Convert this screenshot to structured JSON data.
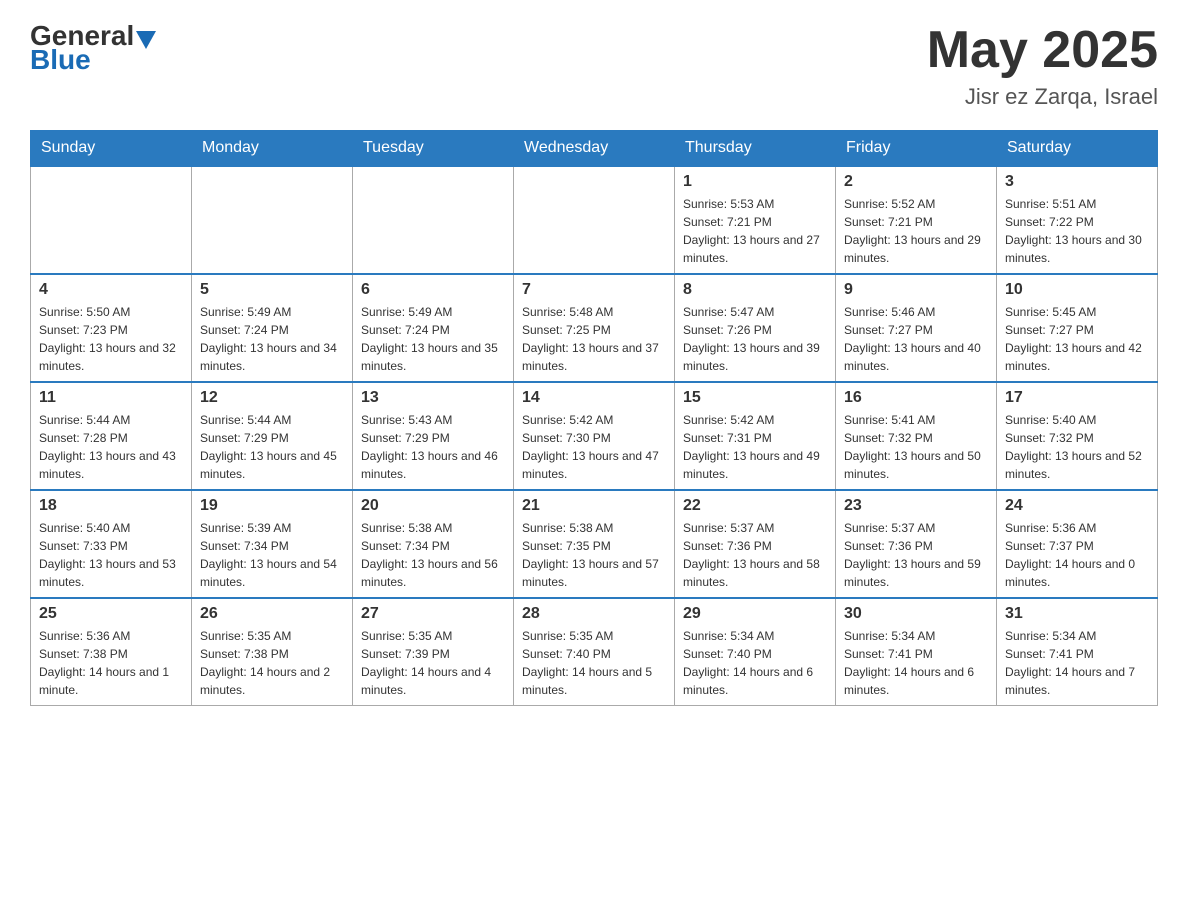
{
  "header": {
    "logo_general": "General",
    "logo_blue": "Blue",
    "main_title": "May 2025",
    "subtitle": "Jisr ez Zarqa, Israel"
  },
  "weekdays": [
    "Sunday",
    "Monday",
    "Tuesday",
    "Wednesday",
    "Thursday",
    "Friday",
    "Saturday"
  ],
  "weeks": [
    [
      {
        "day": "",
        "info": ""
      },
      {
        "day": "",
        "info": ""
      },
      {
        "day": "",
        "info": ""
      },
      {
        "day": "",
        "info": ""
      },
      {
        "day": "1",
        "info": "Sunrise: 5:53 AM\nSunset: 7:21 PM\nDaylight: 13 hours and 27 minutes."
      },
      {
        "day": "2",
        "info": "Sunrise: 5:52 AM\nSunset: 7:21 PM\nDaylight: 13 hours and 29 minutes."
      },
      {
        "day": "3",
        "info": "Sunrise: 5:51 AM\nSunset: 7:22 PM\nDaylight: 13 hours and 30 minutes."
      }
    ],
    [
      {
        "day": "4",
        "info": "Sunrise: 5:50 AM\nSunset: 7:23 PM\nDaylight: 13 hours and 32 minutes."
      },
      {
        "day": "5",
        "info": "Sunrise: 5:49 AM\nSunset: 7:24 PM\nDaylight: 13 hours and 34 minutes."
      },
      {
        "day": "6",
        "info": "Sunrise: 5:49 AM\nSunset: 7:24 PM\nDaylight: 13 hours and 35 minutes."
      },
      {
        "day": "7",
        "info": "Sunrise: 5:48 AM\nSunset: 7:25 PM\nDaylight: 13 hours and 37 minutes."
      },
      {
        "day": "8",
        "info": "Sunrise: 5:47 AM\nSunset: 7:26 PM\nDaylight: 13 hours and 39 minutes."
      },
      {
        "day": "9",
        "info": "Sunrise: 5:46 AM\nSunset: 7:27 PM\nDaylight: 13 hours and 40 minutes."
      },
      {
        "day": "10",
        "info": "Sunrise: 5:45 AM\nSunset: 7:27 PM\nDaylight: 13 hours and 42 minutes."
      }
    ],
    [
      {
        "day": "11",
        "info": "Sunrise: 5:44 AM\nSunset: 7:28 PM\nDaylight: 13 hours and 43 minutes."
      },
      {
        "day": "12",
        "info": "Sunrise: 5:44 AM\nSunset: 7:29 PM\nDaylight: 13 hours and 45 minutes."
      },
      {
        "day": "13",
        "info": "Sunrise: 5:43 AM\nSunset: 7:29 PM\nDaylight: 13 hours and 46 minutes."
      },
      {
        "day": "14",
        "info": "Sunrise: 5:42 AM\nSunset: 7:30 PM\nDaylight: 13 hours and 47 minutes."
      },
      {
        "day": "15",
        "info": "Sunrise: 5:42 AM\nSunset: 7:31 PM\nDaylight: 13 hours and 49 minutes."
      },
      {
        "day": "16",
        "info": "Sunrise: 5:41 AM\nSunset: 7:32 PM\nDaylight: 13 hours and 50 minutes."
      },
      {
        "day": "17",
        "info": "Sunrise: 5:40 AM\nSunset: 7:32 PM\nDaylight: 13 hours and 52 minutes."
      }
    ],
    [
      {
        "day": "18",
        "info": "Sunrise: 5:40 AM\nSunset: 7:33 PM\nDaylight: 13 hours and 53 minutes."
      },
      {
        "day": "19",
        "info": "Sunrise: 5:39 AM\nSunset: 7:34 PM\nDaylight: 13 hours and 54 minutes."
      },
      {
        "day": "20",
        "info": "Sunrise: 5:38 AM\nSunset: 7:34 PM\nDaylight: 13 hours and 56 minutes."
      },
      {
        "day": "21",
        "info": "Sunrise: 5:38 AM\nSunset: 7:35 PM\nDaylight: 13 hours and 57 minutes."
      },
      {
        "day": "22",
        "info": "Sunrise: 5:37 AM\nSunset: 7:36 PM\nDaylight: 13 hours and 58 minutes."
      },
      {
        "day": "23",
        "info": "Sunrise: 5:37 AM\nSunset: 7:36 PM\nDaylight: 13 hours and 59 minutes."
      },
      {
        "day": "24",
        "info": "Sunrise: 5:36 AM\nSunset: 7:37 PM\nDaylight: 14 hours and 0 minutes."
      }
    ],
    [
      {
        "day": "25",
        "info": "Sunrise: 5:36 AM\nSunset: 7:38 PM\nDaylight: 14 hours and 1 minute."
      },
      {
        "day": "26",
        "info": "Sunrise: 5:35 AM\nSunset: 7:38 PM\nDaylight: 14 hours and 2 minutes."
      },
      {
        "day": "27",
        "info": "Sunrise: 5:35 AM\nSunset: 7:39 PM\nDaylight: 14 hours and 4 minutes."
      },
      {
        "day": "28",
        "info": "Sunrise: 5:35 AM\nSunset: 7:40 PM\nDaylight: 14 hours and 5 minutes."
      },
      {
        "day": "29",
        "info": "Sunrise: 5:34 AM\nSunset: 7:40 PM\nDaylight: 14 hours and 6 minutes."
      },
      {
        "day": "30",
        "info": "Sunrise: 5:34 AM\nSunset: 7:41 PM\nDaylight: 14 hours and 6 minutes."
      },
      {
        "day": "31",
        "info": "Sunrise: 5:34 AM\nSunset: 7:41 PM\nDaylight: 14 hours and 7 minutes."
      }
    ]
  ]
}
